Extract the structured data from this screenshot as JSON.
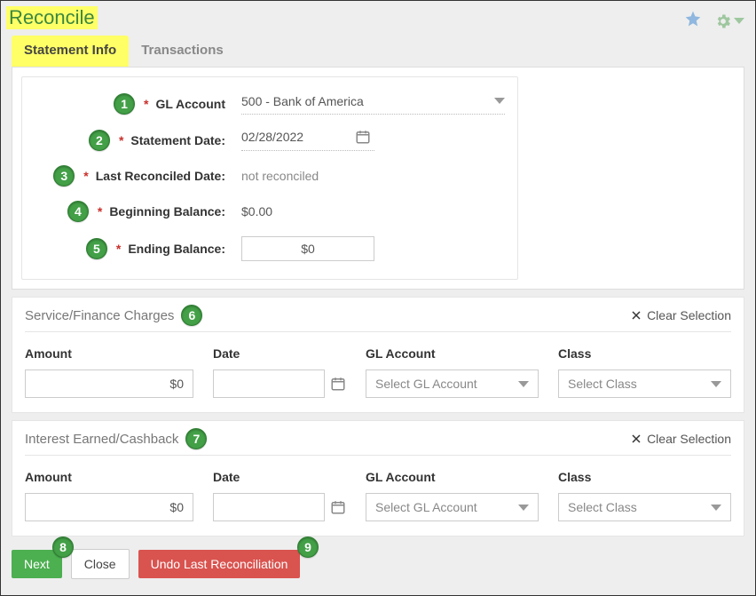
{
  "header": {
    "title": "Reconcile"
  },
  "tabs": {
    "statement_info": "Statement Info",
    "transactions": "Transactions"
  },
  "form": {
    "gl_account_label": "GL Account",
    "gl_account_value": "500 - Bank of America",
    "statement_date_label": "Statement Date:",
    "statement_date_value": "02/28/2022",
    "last_reconciled_label": "Last Reconciled Date:",
    "last_reconciled_value": "not reconciled",
    "beginning_balance_label": "Beginning Balance:",
    "beginning_balance_value": "$0.00",
    "ending_balance_label": "Ending Balance:",
    "ending_balance_value": "$0"
  },
  "badges": {
    "b1": "1",
    "b2": "2",
    "b3": "3",
    "b4": "4",
    "b5": "5",
    "b6": "6",
    "b7": "7",
    "b8": "8",
    "b9": "9"
  },
  "sections": {
    "charges": {
      "title": "Service/Finance Charges",
      "clear": "Clear Selection",
      "amount_label": "Amount",
      "date_label": "Date",
      "gl_label": "GL Account",
      "class_label": "Class",
      "amount_value": "$0",
      "date_value": "",
      "gl_placeholder": "Select GL Account",
      "class_placeholder": "Select Class"
    },
    "interest": {
      "title": "Interest Earned/Cashback",
      "clear": "Clear Selection",
      "amount_label": "Amount",
      "date_label": "Date",
      "gl_label": "GL Account",
      "class_label": "Class",
      "amount_value": "$0",
      "date_value": "",
      "gl_placeholder": "Select GL Account",
      "class_placeholder": "Select Class"
    }
  },
  "actions": {
    "next": "Next",
    "close": "Close",
    "undo": "Undo Last Reconciliation"
  }
}
